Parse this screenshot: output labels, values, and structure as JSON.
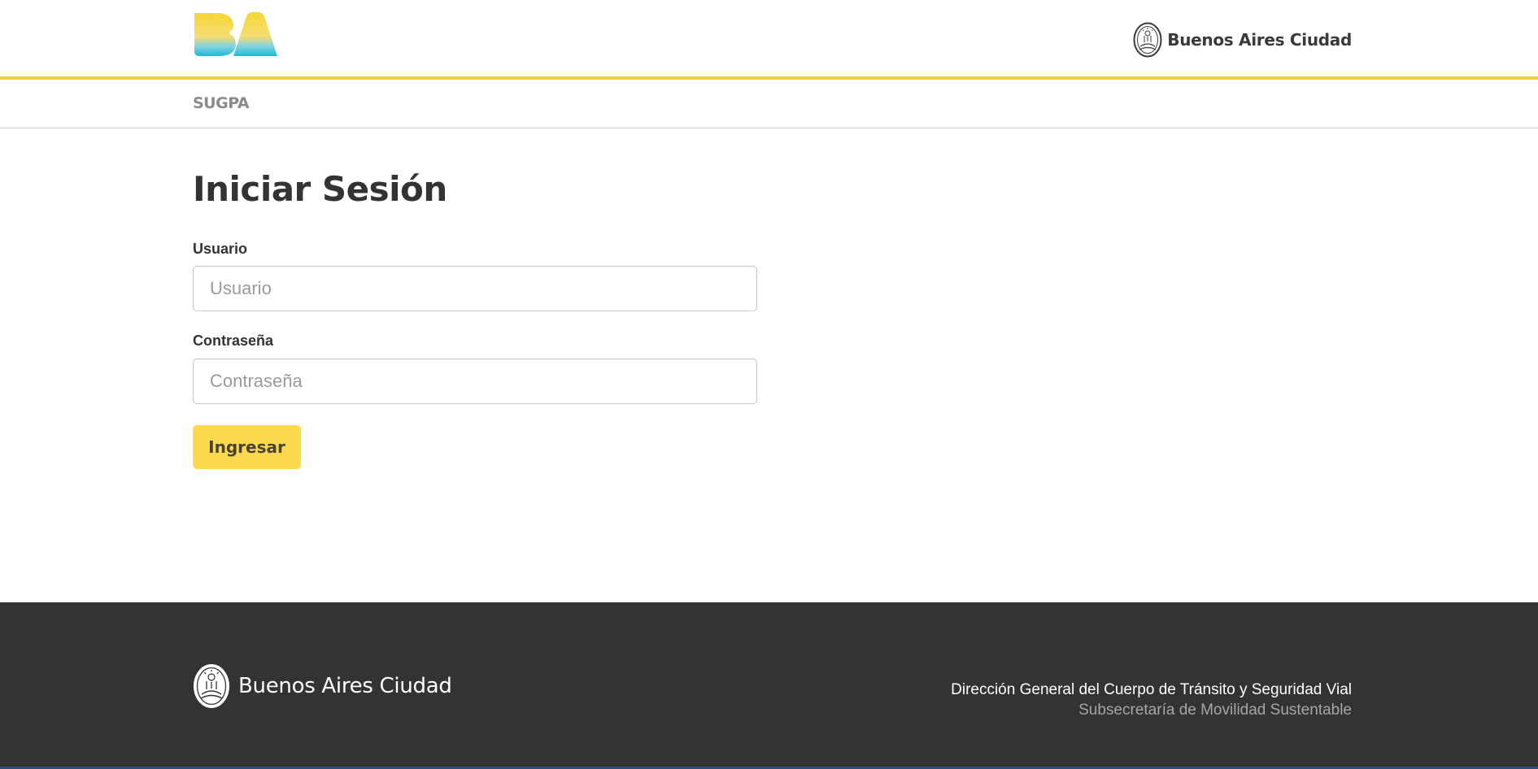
{
  "header": {
    "logo_text": "BA",
    "brand_text": "Buenos Aires Ciudad"
  },
  "subnav": {
    "app_name": "SUGPA"
  },
  "login": {
    "title": "Iniciar Sesión",
    "user_label": "Usuario",
    "user_placeholder": "Usuario",
    "user_value": "",
    "password_label": "Contraseña",
    "password_placeholder": "Contraseña",
    "password_value": "",
    "submit_label": "Ingresar"
  },
  "footer": {
    "brand_text": "Buenos Aires Ciudad",
    "line1": "Dirección General del Cuerpo de Tránsito y Seguridad Vial",
    "line2": "Subsecretaría de Movilidad Sustentable"
  },
  "colors": {
    "accent_yellow": "#f0d33a",
    "button_yellow": "#fcd94f",
    "logo_cyan": "#1fb8d6",
    "footer_bg": "#333333",
    "text_dark": "#333333",
    "text_muted": "#8a8a8a"
  },
  "icons": {
    "header_logo": "ba-logo",
    "header_seal": "city-seal-icon",
    "footer_seal": "city-seal-icon"
  }
}
